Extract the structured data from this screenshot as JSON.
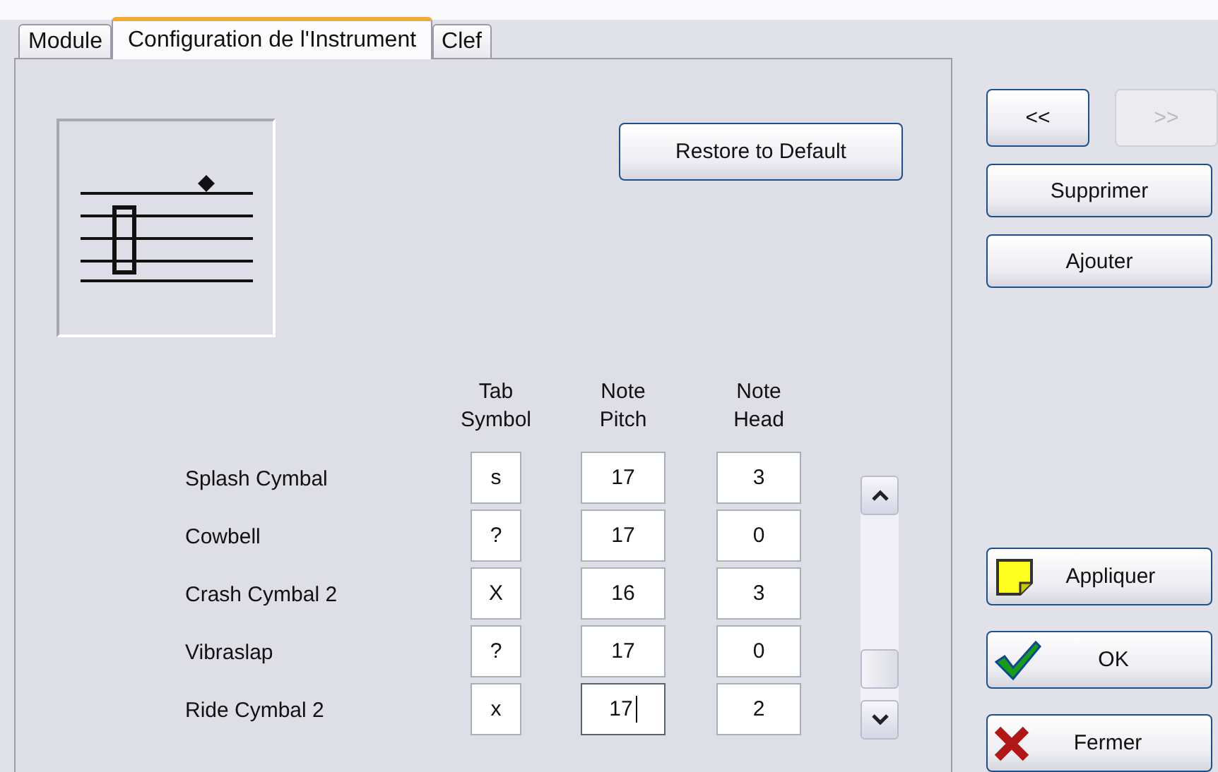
{
  "tabs": [
    {
      "label": "Module",
      "selected": false
    },
    {
      "label": "Configuration de l'Instrument",
      "selected": true
    },
    {
      "label": "Clef",
      "selected": false
    }
  ],
  "restore_button": "Restore to Default",
  "table": {
    "columns": [
      "Tab\nSymbol",
      "Note\nPitch",
      "Note\nHead"
    ],
    "rows": [
      {
        "name": "Splash Cymbal",
        "tab_symbol": "s",
        "note_pitch": "17",
        "note_head": "3",
        "focused": false
      },
      {
        "name": "Cowbell",
        "tab_symbol": "?",
        "note_pitch": "17",
        "note_head": "0",
        "focused": false
      },
      {
        "name": "Crash Cymbal 2",
        "tab_symbol": "X",
        "note_pitch": "16",
        "note_head": "3",
        "focused": false
      },
      {
        "name": "Vibraslap",
        "tab_symbol": "?",
        "note_pitch": "17",
        "note_head": "0",
        "focused": false
      },
      {
        "name": "Ride Cymbal 2",
        "tab_symbol": "x",
        "note_pitch": "17",
        "note_head": "2",
        "focused": true
      }
    ]
  },
  "nav_buttons": [
    {
      "label": "<<",
      "disabled": false
    },
    {
      "label": ">>",
      "disabled": true
    }
  ],
  "side_buttons": [
    "Supprimer",
    "Ajouter"
  ],
  "action_buttons": [
    {
      "label": "Appliquer",
      "kind": "apply"
    },
    {
      "label": "OK",
      "kind": "ok"
    },
    {
      "label": "Fermer",
      "kind": "close"
    }
  ]
}
